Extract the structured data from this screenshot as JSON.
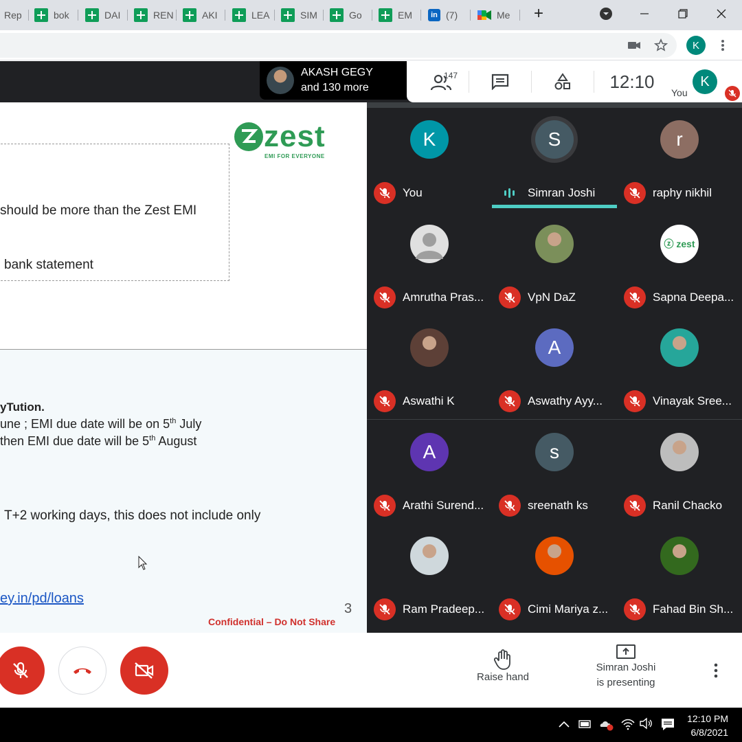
{
  "browser": {
    "tabs": [
      {
        "label": "Rep",
        "icon": "doc-icon"
      },
      {
        "label": "bok",
        "icon": "sheets-icon"
      },
      {
        "label": "DAI",
        "icon": "sheets-icon"
      },
      {
        "label": "REN",
        "icon": "sheets-icon"
      },
      {
        "label": "AKI",
        "icon": "sheets-icon"
      },
      {
        "label": "LEA",
        "icon": "sheets-icon"
      },
      {
        "label": "SIM",
        "icon": "sheets-icon"
      },
      {
        "label": "Go",
        "icon": "sheets-icon"
      },
      {
        "label": "EM",
        "icon": "sheets-icon"
      },
      {
        "label": "(7)",
        "icon": "linkedin-icon"
      },
      {
        "label": "Me",
        "icon": "meet-icon"
      }
    ],
    "new_tab": "+",
    "profile_initial": "K"
  },
  "meet": {
    "presenter_chip": {
      "name": "AKASH GEGY",
      "more": "and 130 more"
    },
    "participant_count": "147",
    "clock": "12:10",
    "you_label": "You",
    "self_initial": "K",
    "participants": [
      {
        "name": "You",
        "initial": "K",
        "color": "#0097a7",
        "muted": true
      },
      {
        "name": "Simran Joshi",
        "initial": "S",
        "color": "#455a64",
        "muted": false,
        "speaking": true
      },
      {
        "name": "raphy nikhil",
        "initial": "r",
        "color": "#8d6e63",
        "muted": true
      },
      {
        "name": "Amrutha Pras...",
        "initial": "",
        "color": "#e0e0e0",
        "muted": true,
        "photo": "default-avatar"
      },
      {
        "name": "VpN DaZ",
        "initial": "",
        "color": "#7b8f5a",
        "muted": true,
        "photo": "photo"
      },
      {
        "name": "Sapna Deepa...",
        "initial": "",
        "color": "#ffffff",
        "muted": true,
        "photo": "zest-logo"
      },
      {
        "name": "Aswathi K",
        "initial": "",
        "color": "#5d4037",
        "muted": true,
        "photo": "photo"
      },
      {
        "name": "Aswathy Ayy...",
        "initial": "A",
        "color": "#5c6bc0",
        "muted": true
      },
      {
        "name": "Vinayak Sree...",
        "initial": "",
        "color": "#26a69a",
        "muted": true,
        "photo": "photo"
      },
      {
        "name": "Arathi Surend...",
        "initial": "A",
        "color": "#5e35b1",
        "muted": true
      },
      {
        "name": "sreenath ks",
        "initial": "s",
        "color": "#455a64",
        "muted": true
      },
      {
        "name": "Ranil Chacko",
        "initial": "",
        "color": "#bdbdbd",
        "muted": true,
        "photo": "photo"
      },
      {
        "name": "Ram Pradeep...",
        "initial": "",
        "color": "#cfd8dc",
        "muted": true,
        "photo": "photo"
      },
      {
        "name": "Cimi Mariya z...",
        "initial": "",
        "color": "#e65100",
        "muted": true,
        "photo": "photo"
      },
      {
        "name": "Fahad Bin Sh...",
        "initial": "",
        "color": "#33691e",
        "muted": true,
        "photo": "photo"
      }
    ],
    "controls": {
      "raise_hand": "Raise hand",
      "presenting_line1": "Simran Joshi",
      "presenting_line2": "is presenting"
    }
  },
  "slide": {
    "logo_word": "zest",
    "logo_tagline": "EMI FOR EVERYONE",
    "line1": "should be more than the Zest EMI",
    "line2": "bank statement",
    "bold_line": "yTution.",
    "line3_pre": "une ; EMI due date will be on 5",
    "line3_sup": "th",
    "line3_post": " July",
    "line4_pre": "then EMI due date will be 5",
    "line4_sup": "th",
    "line4_post": " August",
    "line5": "T+2 working days, this does not include only",
    "link": "ey.in/pd/loans",
    "page_number": "3",
    "confidential": "Confidential – Do Not Share"
  },
  "taskbar": {
    "time": "12:10 PM",
    "date": "6/8/2021"
  }
}
